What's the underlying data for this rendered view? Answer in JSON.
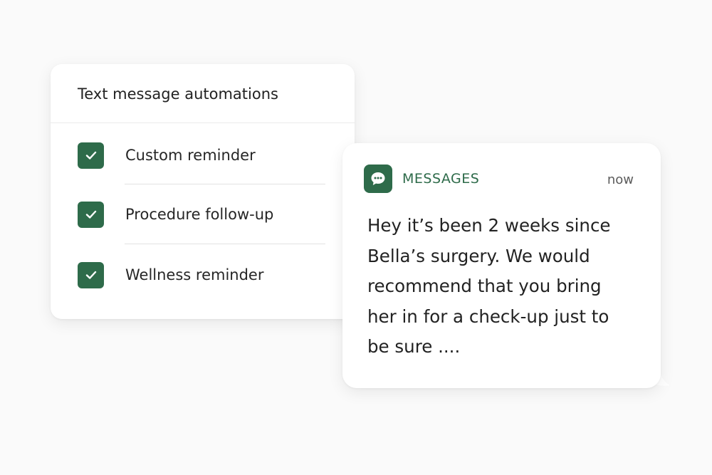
{
  "automations": {
    "title": "Text message automations",
    "items": [
      {
        "label": "Custom reminder",
        "checked": true
      },
      {
        "label": "Procedure follow-up",
        "checked": true
      },
      {
        "label": "Wellness reminder",
        "checked": true
      }
    ],
    "checkbox_icon": "check-icon"
  },
  "message": {
    "app_name": "MESSAGES",
    "app_icon": "chat-bubble-icon",
    "time": "now",
    "body": "Hey it’s been 2 weeks since Bella’s surgery. We would recommend that you bring her in for a check-up just to be sure ...."
  },
  "colors": {
    "accent": "#2e6b4a",
    "background": "#fafafa",
    "card": "#ffffff"
  }
}
